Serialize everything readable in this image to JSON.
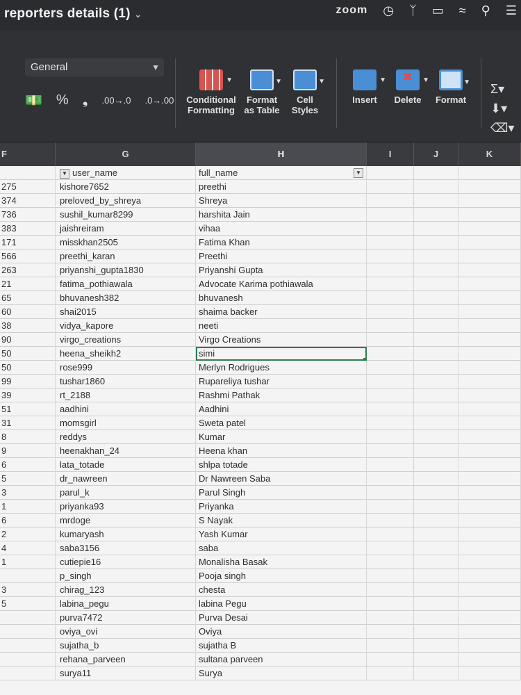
{
  "window": {
    "title": "reporters details (1)",
    "zoom_label": "zoom"
  },
  "ribbon": {
    "number_format": "General",
    "tools": {
      "conditional_formatting": "Conditional Formatting",
      "format_as_table": "Format as Table",
      "cell_styles": "Cell Styles",
      "insert": "Insert",
      "delete": "Delete",
      "format": "Format"
    },
    "format_symbols": {
      "percent": "%",
      "comma": "❟",
      "inc_decimal": ".00→.0",
      "dec_decimal": ".0→.00"
    }
  },
  "columns": [
    "F",
    "G",
    "H",
    "I",
    "J",
    "K"
  ],
  "table": {
    "header_g": "user_name",
    "header_h": "full_name",
    "rows": [
      {
        "f": "275",
        "user": "kishore7652",
        "name": "preethi"
      },
      {
        "f": "374",
        "user": "preloved_by_shreya",
        "name": "Shreya"
      },
      {
        "f": "736",
        "user": "sushil_kumar8299",
        "name": "harshita Jain"
      },
      {
        "f": "383",
        "user": "jaishreiram",
        "name": "vihaa"
      },
      {
        "f": "171",
        "user": "misskhan2505",
        "name": "Fatima Khan"
      },
      {
        "f": "566",
        "user": "preethi_karan",
        "name": "Preethi"
      },
      {
        "f": "263",
        "user": "priyanshi_gupta1830",
        "name": "Priyanshi Gupta"
      },
      {
        "f": "21",
        "user": "fatima_pothiawala",
        "name": "Advocate Karima pothiawala"
      },
      {
        "f": "65",
        "user": "bhuvanesh382",
        "name": "bhuvanesh"
      },
      {
        "f": "60",
        "user": "shai2015",
        "name": "shaima backer"
      },
      {
        "f": "38",
        "user": "vidya_kapore",
        "name": "neeti"
      },
      {
        "f": "90",
        "user": "virgo_creations",
        "name": "Virgo Creations"
      },
      {
        "f": "50",
        "user": "heena_sheikh2",
        "name": "simi"
      },
      {
        "f": "50",
        "user": "rose999",
        "name": "Merlyn Rodrigues"
      },
      {
        "f": "99",
        "user": "tushar1860",
        "name": "Rupareliya tushar"
      },
      {
        "f": "39",
        "user": "rt_2188",
        "name": "Rashmi Pathak"
      },
      {
        "f": "51",
        "user": "aadhini",
        "name": "Aadhini"
      },
      {
        "f": "31",
        "user": "momsgirl",
        "name": "Sweta patel"
      },
      {
        "f": "8",
        "user": "reddys",
        "name": "Kumar"
      },
      {
        "f": "9",
        "user": "heenakhan_24",
        "name": "Heena khan"
      },
      {
        "f": "6",
        "user": "lata_totade",
        "name": "shlpa totade"
      },
      {
        "f": "5",
        "user": "dr_nawreen",
        "name": "Dr Nawreen Saba"
      },
      {
        "f": "3",
        "user": "parul_k",
        "name": "Parul Singh"
      },
      {
        "f": "1",
        "user": "priyanka93",
        "name": "Priyanka"
      },
      {
        "f": "6",
        "user": "mrdoge",
        "name": "S Nayak"
      },
      {
        "f": "2",
        "user": "kumaryash",
        "name": "Yash Kumar"
      },
      {
        "f": "4",
        "user": "saba3156",
        "name": "saba"
      },
      {
        "f": "1",
        "user": "cutiepie16",
        "name": "Monalisha Basak"
      },
      {
        "f": "",
        "user": "p_singh",
        "name": "Pooja singh"
      },
      {
        "f": "3",
        "user": "chirag_123",
        "name": "chesta"
      },
      {
        "f": "5",
        "user": "labina_pegu",
        "name": "labina Pegu"
      },
      {
        "f": "",
        "user": "purva7472",
        "name": "Purva Desai"
      },
      {
        "f": "",
        "user": "oviya_ovi",
        "name": "Oviya"
      },
      {
        "f": "",
        "user": "sujatha_b",
        "name": "sujatha B"
      },
      {
        "f": "",
        "user": "rehana_parveen",
        "name": "sultana parveen"
      },
      {
        "f": "",
        "user": "surya11",
        "name": "Surya"
      }
    ],
    "selected_cell_row_index": 12
  }
}
